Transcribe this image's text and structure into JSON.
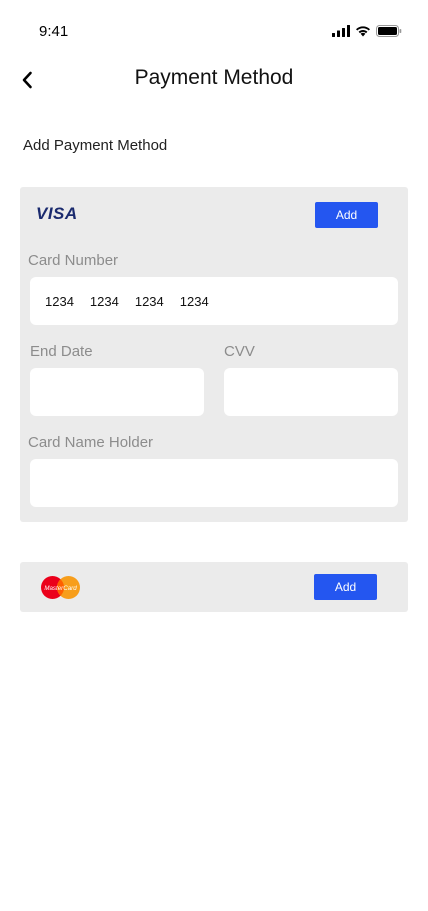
{
  "status_bar": {
    "time": "9:41"
  },
  "header": {
    "title": "Payment Method"
  },
  "section": {
    "title": "Add Payment Method"
  },
  "visa_card": {
    "brand": "VISA",
    "add_label": "Add",
    "card_number_label": "Card Number",
    "card_number_groups": [
      "1234",
      "1234",
      "1234",
      "1234"
    ],
    "end_date_label": "End Date",
    "end_date_value": "",
    "cvv_label": "CVV",
    "cvv_value": "",
    "holder_label": "Card Name Holder",
    "holder_value": ""
  },
  "mastercard": {
    "brand": "MasterCard",
    "add_label": "Add"
  },
  "colors": {
    "accent": "#2456f0",
    "panel": "#ebebeb",
    "visa_blue": "#1a2a6e",
    "mc_red": "#eb001b",
    "mc_orange": "#f79e1b"
  }
}
